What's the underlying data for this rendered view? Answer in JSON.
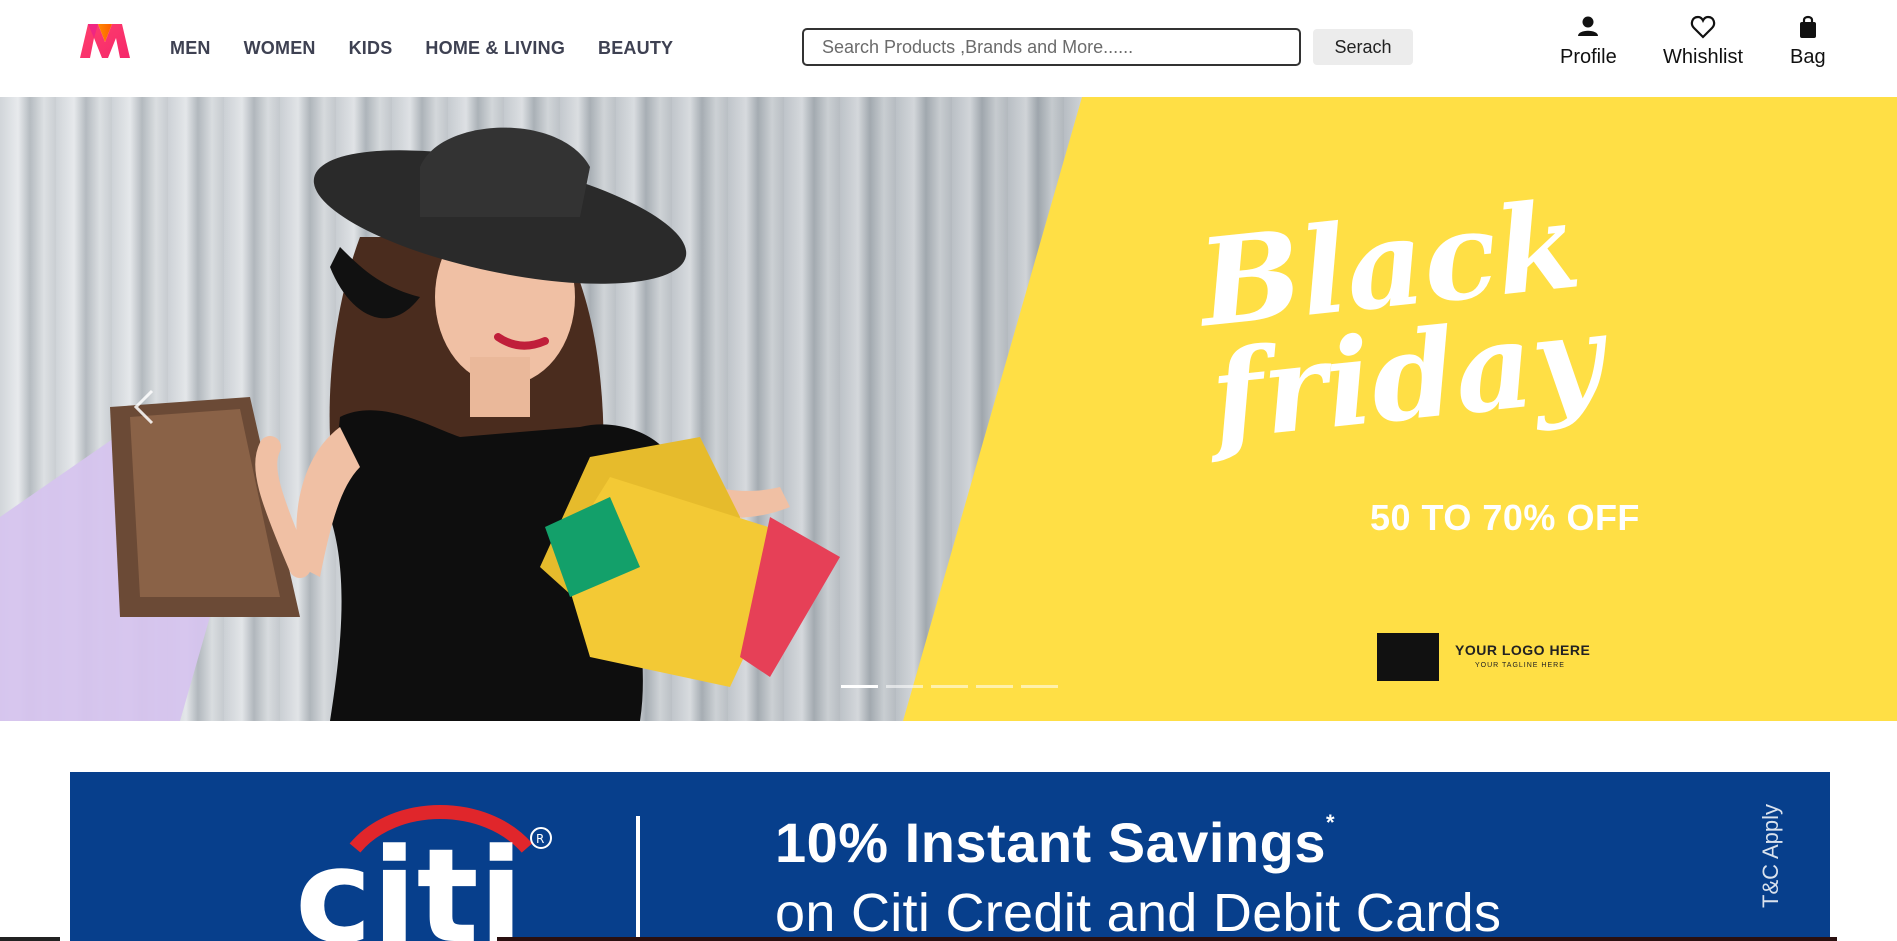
{
  "nav": {
    "links": [
      "MEN",
      "WOMEN",
      "KIDS",
      "HOME & LIVING",
      "BEAUTY"
    ],
    "search_placeholder": "Search Products ,Brands and More......",
    "search_button": "Serach",
    "actions": {
      "profile": "Profile",
      "wishlist": "Whishlist",
      "bag": "Bag"
    }
  },
  "hero": {
    "headline_1": "Black",
    "headline_2": "friday",
    "offer": "50 TO 70% OFF",
    "logo_text": "YOUR LOGO HERE",
    "tagline": "YOUR TAGLINE HERE",
    "slide_count": 5,
    "active_slide": 1
  },
  "citi": {
    "brand": "citi",
    "savings_line_1": "10% Instant Savings",
    "savings_asterisk": "*",
    "savings_line_2": "on Citi Credit and Debit Cards",
    "tc": "T&C Apply"
  },
  "colors": {
    "hero_yellow": "#ffdf45",
    "citi_blue": "#073f8c",
    "citi_red": "#e0262b",
    "offer_pink": "#e8184f"
  }
}
